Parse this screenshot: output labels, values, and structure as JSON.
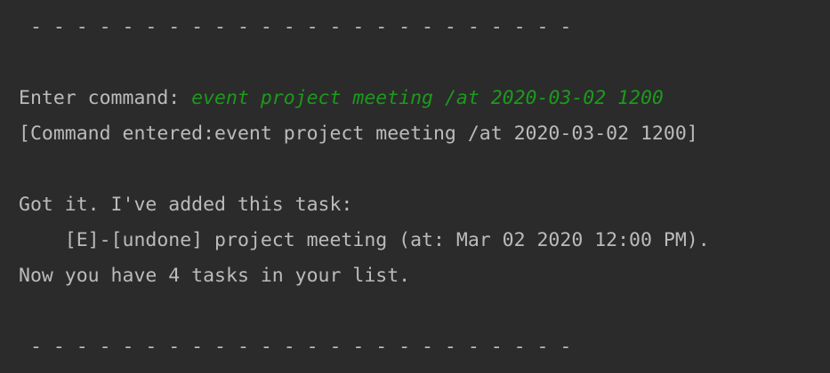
{
  "console": {
    "separator_top": " - - - - - - - - - - - - - - - - - - - - - - - -",
    "prompt_label": "Enter command: ",
    "user_input": "event project meeting /at 2020-03-02 1200",
    "echo": "[Command entered:event project meeting /at 2020-03-02 1200]",
    "ack": "Got it. I've added this task:",
    "task": "    [E]-[undone] project meeting (at: Mar 02 2020 12:00 PM).",
    "count": "Now you have 4 tasks in your list.",
    "separator_bottom": " - - - - - - - - - - - - - - - - - - - - - - - -"
  },
  "colors": {
    "background": "#2b2b2b",
    "text": "#bbbbbb",
    "user_input": "#1c9a1c"
  }
}
